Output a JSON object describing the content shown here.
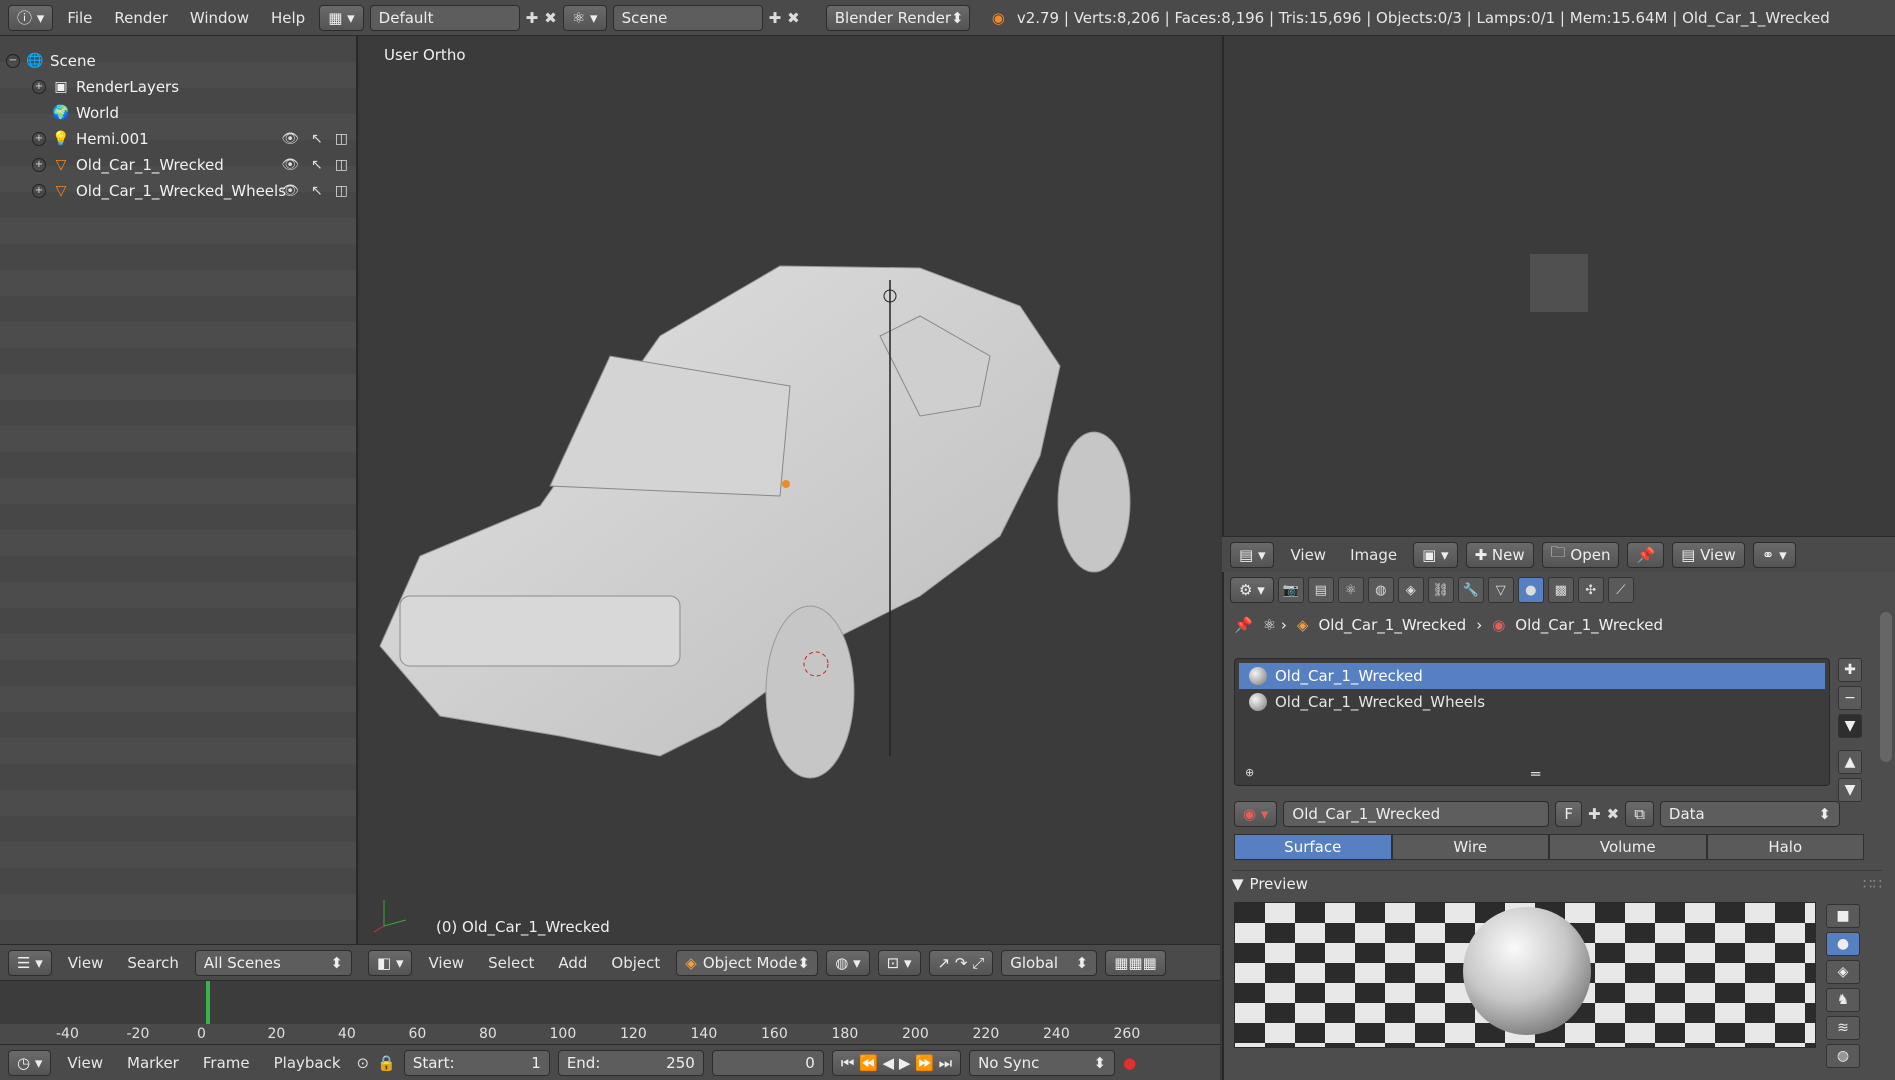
{
  "topbar": {
    "menus": [
      "File",
      "Render",
      "Window",
      "Help"
    ],
    "layout": "Default",
    "scene": "Scene",
    "engine": "Blender Render",
    "info": "v2.79 | Verts:8,206 | Faces:8,196 | Tris:15,696 | Objects:0/3 | Lamps:0/1 | Mem:15.64M | Old_Car_1_Wrecked"
  },
  "outliner": {
    "items": [
      {
        "label": "Scene"
      },
      {
        "label": "RenderLayers"
      },
      {
        "label": "World"
      },
      {
        "label": "Hemi.001"
      },
      {
        "label": "Old_Car_1_Wrecked"
      },
      {
        "label": "Old_Car_1_Wrecked_Wheels"
      }
    ],
    "header": {
      "view": "View",
      "search": "Search",
      "filter": "All Scenes"
    }
  },
  "viewport": {
    "label": "User Ortho",
    "object": "(0) Old_Car_1_Wrecked",
    "header": {
      "view": "View",
      "select": "Select",
      "add": "Add",
      "object": "Object",
      "mode": "Object Mode",
      "orientation": "Global"
    }
  },
  "timeline": {
    "ticks": [
      "-40",
      "-20",
      "0",
      "20",
      "40",
      "60",
      "80",
      "100",
      "120",
      "140",
      "160",
      "180",
      "200",
      "220",
      "240",
      "260"
    ],
    "header": {
      "view": "View",
      "marker": "Marker",
      "frame": "Frame",
      "playback": "Playback",
      "start_label": "Start:",
      "start": "1",
      "end_label": "End:",
      "end": "250",
      "current": "0",
      "sync": "No Sync"
    }
  },
  "image_editor": {
    "header": {
      "view": "View",
      "image": "Image",
      "new": "New",
      "open": "Open",
      "view2": "View"
    }
  },
  "properties": {
    "crumb_object": "Old_Car_1_Wrecked",
    "crumb_material": "Old_Car_1_Wrecked",
    "materials": [
      "Old_Car_1_Wrecked",
      "Old_Car_1_Wrecked_Wheels"
    ],
    "material_name": "Old_Car_1_Wrecked",
    "fake_user": "F",
    "link": "Data",
    "tabs": [
      "Surface",
      "Wire",
      "Volume",
      "Halo"
    ],
    "preview_title": "Preview"
  },
  "colors": {
    "accent": "#5680c2",
    "background": "#393939"
  }
}
